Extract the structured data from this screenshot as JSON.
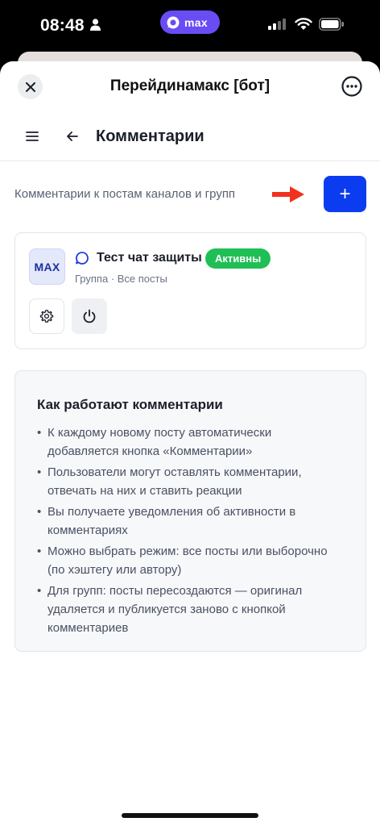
{
  "status_bar": {
    "time": "08:48",
    "pill_label": "max"
  },
  "header": {
    "bot_title": "Перейдинамакс [бот]"
  },
  "nav": {
    "page_title": "Комментарии"
  },
  "intro": {
    "description": "Комментарии к постам каналов и групп",
    "add_button_label": "+"
  },
  "chat": {
    "avatar_text": "MAX",
    "name": "Тест чат защиты",
    "status": "Активны",
    "subtitle": "Группа · Все посты"
  },
  "info": {
    "title": "Как работают комментарии",
    "items": [
      "К каждому новому посту автоматически добавляется кнопка «Комментарии»",
      "Пользователи могут оставлять комментарии, отвечать на них и ставить реакции",
      "Вы получаете уведомления об активности в комментариях",
      "Можно выбрать режим: все посты или выборочно (по хэштегу или автору)",
      "Для групп: посты пересоздаются — оригинал удаляется и публикуется заново с кнопкой комментариев"
    ]
  },
  "colors": {
    "accent": "#0b3cf0",
    "status_active": "#1fbf55",
    "pill": "#6a4cf5",
    "arrow": "#f0321e"
  },
  "icons": [
    "person-icon",
    "signal-icon",
    "wifi-icon",
    "battery-icon",
    "close-icon",
    "more-icon",
    "menu-icon",
    "back-arrow-icon",
    "chat-bubble-icon",
    "gear-icon",
    "power-icon"
  ]
}
